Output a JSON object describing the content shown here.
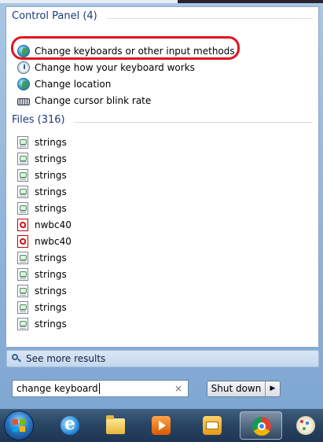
{
  "control_panel": {
    "header": "Control Panel (4)",
    "items": [
      {
        "label": "Change keyboards or other input methods",
        "icon": "globe-icon"
      },
      {
        "label": "Change how your keyboard works",
        "icon": "gauge-icon"
      },
      {
        "label": "Change location",
        "icon": "globe-icon"
      },
      {
        "label": "Change cursor blink rate",
        "icon": "keyboard-icon"
      }
    ]
  },
  "files": {
    "header": "Files (316)",
    "items": [
      {
        "label": "strings",
        "icon": "document-icon"
      },
      {
        "label": "strings",
        "icon": "document-icon"
      },
      {
        "label": "strings",
        "icon": "document-icon"
      },
      {
        "label": "strings",
        "icon": "document-icon"
      },
      {
        "label": "strings",
        "icon": "document-icon"
      },
      {
        "label": "nwbc40",
        "icon": "pdf-icon"
      },
      {
        "label": "nwbc40",
        "icon": "pdf-icon"
      },
      {
        "label": "strings",
        "icon": "document-icon"
      },
      {
        "label": "strings",
        "icon": "document-icon"
      },
      {
        "label": "strings",
        "icon": "document-icon"
      },
      {
        "label": "strings",
        "icon": "document-icon"
      },
      {
        "label": "strings",
        "icon": "document-icon"
      }
    ]
  },
  "see_more": {
    "label": "See more results"
  },
  "search": {
    "value": "change keyboard",
    "clear_glyph": "×"
  },
  "shutdown": {
    "label": "Shut down",
    "arrow_glyph": "▶"
  },
  "taskbar": {
    "items": [
      "start-orb",
      "internet-explorer-icon",
      "file-explorer-icon",
      "media-player-icon",
      "outlook-icon",
      "chrome-icon",
      "paint-icon"
    ],
    "active": "chrome-icon"
  },
  "colors": {
    "highlight_ring": "#e0141e",
    "group_header": "#1e3a78"
  }
}
